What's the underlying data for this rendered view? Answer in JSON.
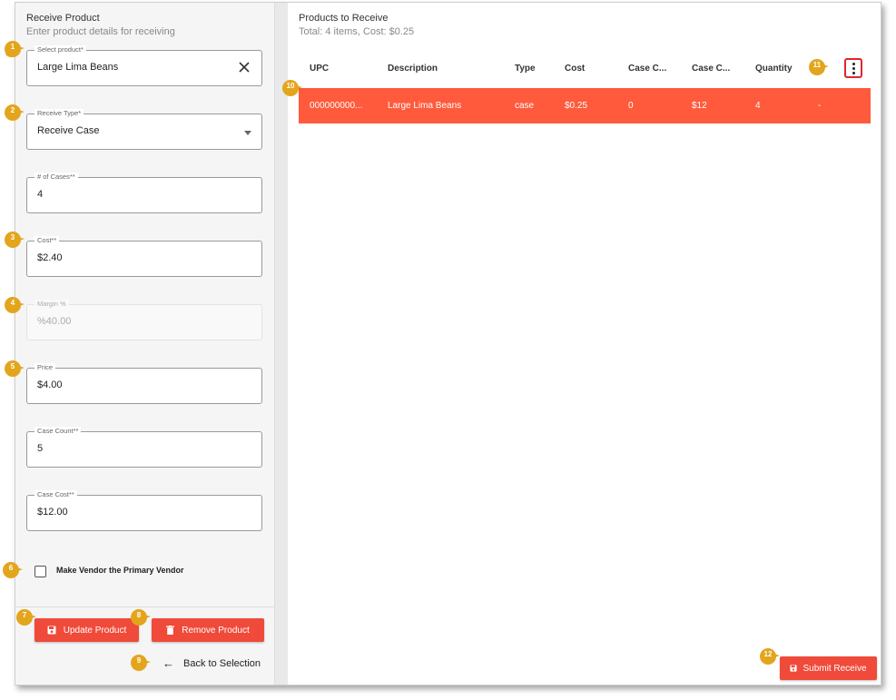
{
  "left_panel": {
    "title": "Receive Product",
    "subtitle": "Enter product details for receiving",
    "fields": {
      "select_product": {
        "label": "Select product*",
        "value": "Large Lima Beans"
      },
      "receive_type": {
        "label": "Receive Type*",
        "value": "Receive Case"
      },
      "num_cases": {
        "label": "# of Cases**",
        "value": "4"
      },
      "cost": {
        "label": "Cost**",
        "value": "$2.40"
      },
      "margin": {
        "label": "Margin %",
        "value": "%40.00"
      },
      "price": {
        "label": "Price",
        "value": "$4.00"
      },
      "case_count": {
        "label": "Case Count**",
        "value": "5"
      },
      "case_cost": {
        "label": "Case Cost**",
        "value": "$12.00"
      }
    },
    "primary_vendor_label": "Make Vendor the Primary Vendor",
    "update_button": "Update Product",
    "remove_button": "Remove Product",
    "back_link": "Back to Selection"
  },
  "right_panel": {
    "title": "Products to Receive",
    "summary": "Total: 4 items, Cost: $0.25",
    "columns": [
      "UPC",
      "Description",
      "Type",
      "Cost",
      "Case C...",
      "Case C...",
      "Quantity"
    ],
    "rows": [
      {
        "upc": "000000000...",
        "description": "Large Lima Beans",
        "type": "case",
        "cost": "$0.25",
        "case_count": "0",
        "case_cost": "$12",
        "quantity": "4",
        "extra": "-"
      }
    ],
    "submit_button": "Submit Receive"
  },
  "callouts": [
    "1",
    "2",
    "3",
    "4",
    "5",
    "6",
    "7",
    "8",
    "9",
    "10",
    "11",
    "12"
  ],
  "colors": {
    "accent": "#f04a3a",
    "selected_row": "#ff5a3c",
    "callout": "#e3a51c",
    "highlight_box": "#e0262b"
  }
}
